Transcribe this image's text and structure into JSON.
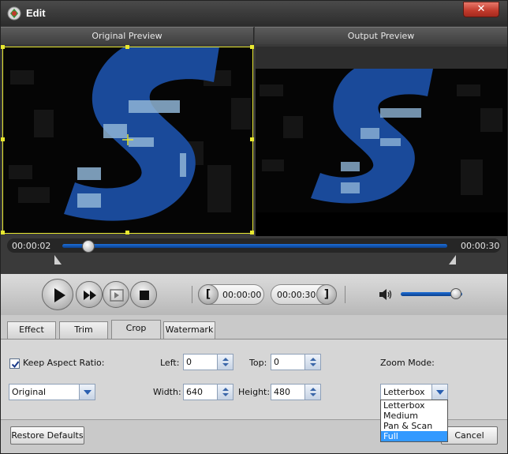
{
  "window": {
    "title": "Edit",
    "close_glyph": "✕"
  },
  "preview": {
    "original_label": "Original Preview",
    "output_label": "Output Preview"
  },
  "timeline": {
    "current": "00:00:02",
    "end": "00:00:30",
    "position_fraction": 0.067
  },
  "playback": {
    "start_time": "00:00:00",
    "end_time": "00:00:30",
    "start_bracket": "[",
    "end_bracket": "]",
    "volume_fraction": 0.9
  },
  "tabs": [
    {
      "label": "Effect",
      "active": false
    },
    {
      "label": "Trim",
      "active": false
    },
    {
      "label": "Crop",
      "active": true
    },
    {
      "label": "Watermark",
      "active": false
    }
  ],
  "crop": {
    "keep_aspect_label": "Keep Aspect Ratio:",
    "keep_aspect_checked": true,
    "aspect_value": "Original",
    "left_label": "Left:",
    "left_value": "0",
    "top_label": "Top:",
    "top_value": "0",
    "width_label": "Width:",
    "width_value": "640",
    "height_label": "Height:",
    "height_value": "480",
    "zoom_label": "Zoom Mode:",
    "zoom_value": "Letterbox",
    "zoom_options": [
      "Letterbox",
      "Medium",
      "Pan & Scan",
      "Full"
    ],
    "zoom_highlighted": "Full"
  },
  "buttons": {
    "restore": "Restore Defaults",
    "cancel": "Cancel"
  },
  "colors": {
    "accent": "#1d6fd6",
    "crop_frame": "#e8e830",
    "close": "#c0392b"
  }
}
